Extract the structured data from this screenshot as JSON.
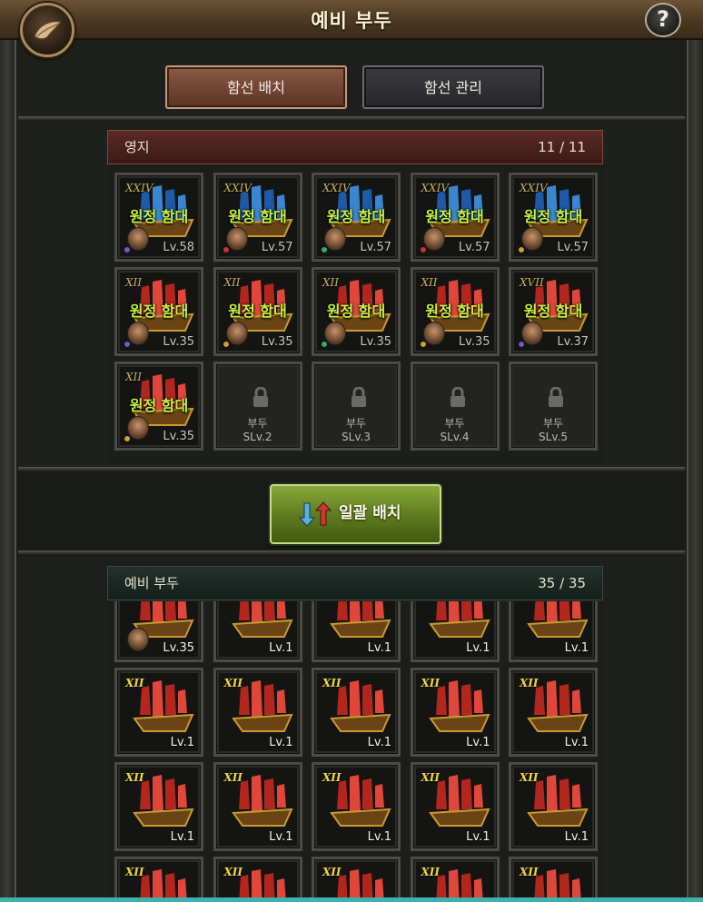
{
  "header": {
    "title": "예비 부두",
    "help_label": "?"
  },
  "tabs": [
    {
      "label": "함선 배치",
      "active": true
    },
    {
      "label": "함선 관리",
      "active": false
    }
  ],
  "territory": {
    "label": "영지",
    "count": "11 / 11",
    "rows": [
      [
        {
          "tier": "XXIV",
          "status": "원정 함대",
          "level": "Lv.58",
          "sail": "blue",
          "gem": "#7a55c8"
        },
        {
          "tier": "XXIV",
          "status": "원정 함대",
          "level": "Lv.57",
          "sail": "blue",
          "gem": "#d03030"
        },
        {
          "tier": "XXIV",
          "status": "원정 함대",
          "level": "Lv.57",
          "sail": "blue",
          "gem": "#30b060"
        },
        {
          "tier": "XXIV",
          "status": "원정 함대",
          "level": "Lv.57",
          "sail": "blue",
          "gem": "#d03030"
        },
        {
          "tier": "XXIV",
          "status": "원정 함대",
          "level": "Lv.57",
          "sail": "blue",
          "gem": "#d0a030"
        }
      ],
      [
        {
          "tier": "XII",
          "status": "원정 함대",
          "level": "Lv.35",
          "sail": "red",
          "gem": "#7a55c8"
        },
        {
          "tier": "XII",
          "status": "원정 함대",
          "level": "Lv.35",
          "sail": "red",
          "gem": "#d0a030"
        },
        {
          "tier": "XII",
          "status": "원정 함대",
          "level": "Lv.35",
          "sail": "red",
          "gem": "#30b060"
        },
        {
          "tier": "XII",
          "status": "원정 함대",
          "level": "Lv.35",
          "sail": "red",
          "gem": "#d0a030"
        },
        {
          "tier": "XVII",
          "status": "원정 함대",
          "level": "Lv.37",
          "sail": "red",
          "gem": "#7a55c8"
        }
      ],
      [
        {
          "tier": "XII",
          "status": "원정 함대",
          "level": "Lv.35",
          "sail": "red",
          "gem": "#d0a030"
        },
        {
          "locked": true,
          "lock_label": "부두",
          "lock_req": "SLv.2"
        },
        {
          "locked": true,
          "lock_label": "부두",
          "lock_req": "SLv.3"
        },
        {
          "locked": true,
          "lock_label": "부두",
          "lock_req": "SLv.4"
        },
        {
          "locked": true,
          "lock_label": "부두",
          "lock_req": "SLv.5"
        }
      ]
    ]
  },
  "bulk_button": {
    "label": "일괄 배치"
  },
  "reserve": {
    "label": "예비 부두",
    "count": "35 / 35",
    "rows": [
      [
        {
          "tier": "",
          "level": "Lv.35",
          "avatar": true
        },
        {
          "tier": "",
          "level": "Lv.1"
        },
        {
          "tier": "",
          "level": "Lv.1"
        },
        {
          "tier": "",
          "level": "Lv.1"
        },
        {
          "tier": "",
          "level": "Lv.1"
        }
      ],
      [
        {
          "tier": "XII",
          "level": "Lv.1"
        },
        {
          "tier": "XII",
          "level": "Lv.1"
        },
        {
          "tier": "XII",
          "level": "Lv.1"
        },
        {
          "tier": "XII",
          "level": "Lv.1"
        },
        {
          "tier": "XII",
          "level": "Lv.1"
        }
      ],
      [
        {
          "tier": "XII",
          "level": "Lv.1"
        },
        {
          "tier": "XII",
          "level": "Lv.1"
        },
        {
          "tier": "XII",
          "level": "Lv.1"
        },
        {
          "tier": "XII",
          "level": "Lv.1"
        },
        {
          "tier": "XII",
          "level": "Lv.1"
        }
      ],
      [
        {
          "tier": "XII",
          "level": ""
        },
        {
          "tier": "XII",
          "level": ""
        },
        {
          "tier": "XII",
          "level": ""
        },
        {
          "tier": "XII",
          "level": ""
        },
        {
          "tier": "XII",
          "level": ""
        }
      ]
    ]
  },
  "colors": {
    "accent_green": "#c8f240",
    "territory_header": "#4a221c",
    "reserve_header": "#1c2a24",
    "button_green": "#6a8a28"
  }
}
